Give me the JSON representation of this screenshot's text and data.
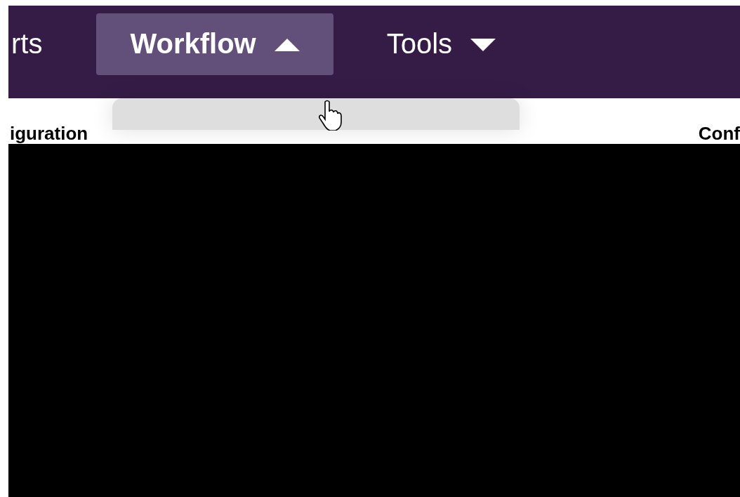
{
  "nav": {
    "items": [
      {
        "label": "rts",
        "kind": "link",
        "selected": false
      },
      {
        "label": "Workflow",
        "kind": "menu",
        "selected": true,
        "expanded": true
      },
      {
        "label": "Tools",
        "kind": "menu",
        "selected": false,
        "expanded": false
      }
    ]
  },
  "content": {
    "fragments": [
      "iguration",
      "Conf"
    ]
  }
}
